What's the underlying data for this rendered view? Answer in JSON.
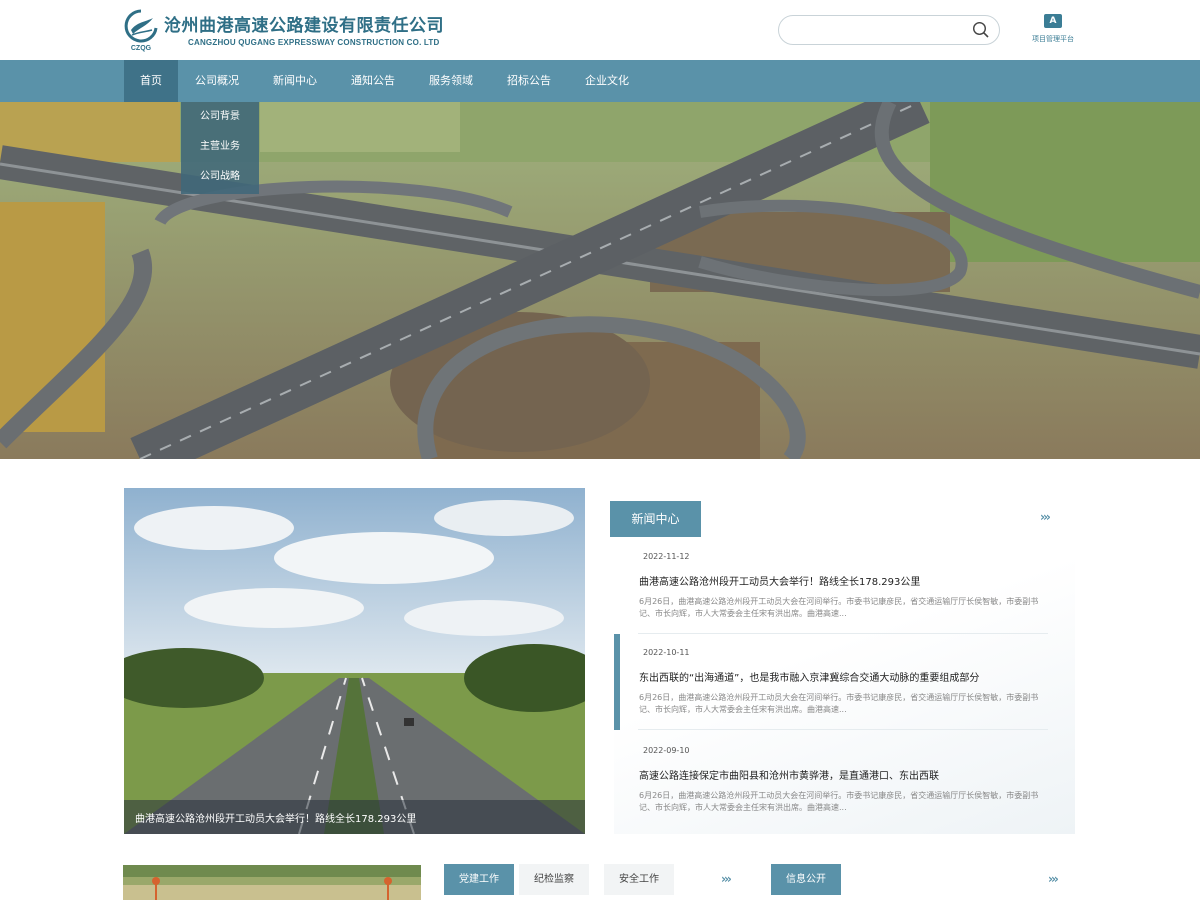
{
  "header": {
    "logo_text": "CZQG",
    "company_cn": "沧州曲港高速公路建设有限责任公司",
    "company_en": "CANGZHOU QUGANG EXPRESSWAY CONSTRUCTION CO. LTD",
    "search": {
      "placeholder": "",
      "value": ""
    },
    "platform_icon_letter": "A",
    "platform_label": "项目管理平台"
  },
  "nav": {
    "items": [
      "首页",
      "公司概况",
      "新闻中心",
      "通知公告",
      "服务领域",
      "招标公告",
      "企业文化"
    ],
    "active": "首页",
    "dropdown": [
      "公司背景",
      "主营业务",
      "公司战略"
    ]
  },
  "slider": {
    "caption": "曲港高速公路沧州段开工动员大会举行！路线全长178.293公里",
    "dot_count": 5,
    "active_dot": 2
  },
  "news": {
    "tab": "新闻中心",
    "more": "›››",
    "items": [
      {
        "date": "2022-11-12",
        "title": "曲港高速公路沧州段开工动员大会举行！路线全长178.293公里",
        "desc": "6月26日，曲港高速公路沧州段开工动员大会在河间举行。市委书记康彦民，省交通运输厅厅长侯智敏，市委副书记、市长向辉，市人大常委会主任宋有洪出席。曲港高速..."
      },
      {
        "date": "2022-10-11",
        "title": "东出西联的“出海通道”，也是我市融入京津冀综合交通大动脉的重要组成部分",
        "desc": "6月26日，曲港高速公路沧州段开工动员大会在河间举行。市委书记康彦民，省交通运输厅厅长侯智敏，市委副书记、市长向辉，市人大常委会主任宋有洪出席。曲港高速..."
      },
      {
        "date": "2022-09-10",
        "title": "高速公路连接保定市曲阳县和沧州市黄骅港，是直通港口、东出西联",
        "desc": "6月26日，曲港高速公路沧州段开工动员大会在河间举行。市委书记康彦民，省交通运输厅厅长侯智敏，市委副书记、市长向辉，市人大常委会主任宋有洪出席。曲港高速..."
      }
    ],
    "active_index": 1
  },
  "bottom": {
    "tabs": [
      "党建工作",
      "纪检监察",
      "安全工作"
    ],
    "active_tab": "党建工作",
    "more": "›››",
    "info_tab": "信息公开",
    "info_more": "›››"
  },
  "colors": {
    "primary": "#5a92a9",
    "primary_dark": "#3f7288",
    "brand_text": "#2f6f86"
  }
}
